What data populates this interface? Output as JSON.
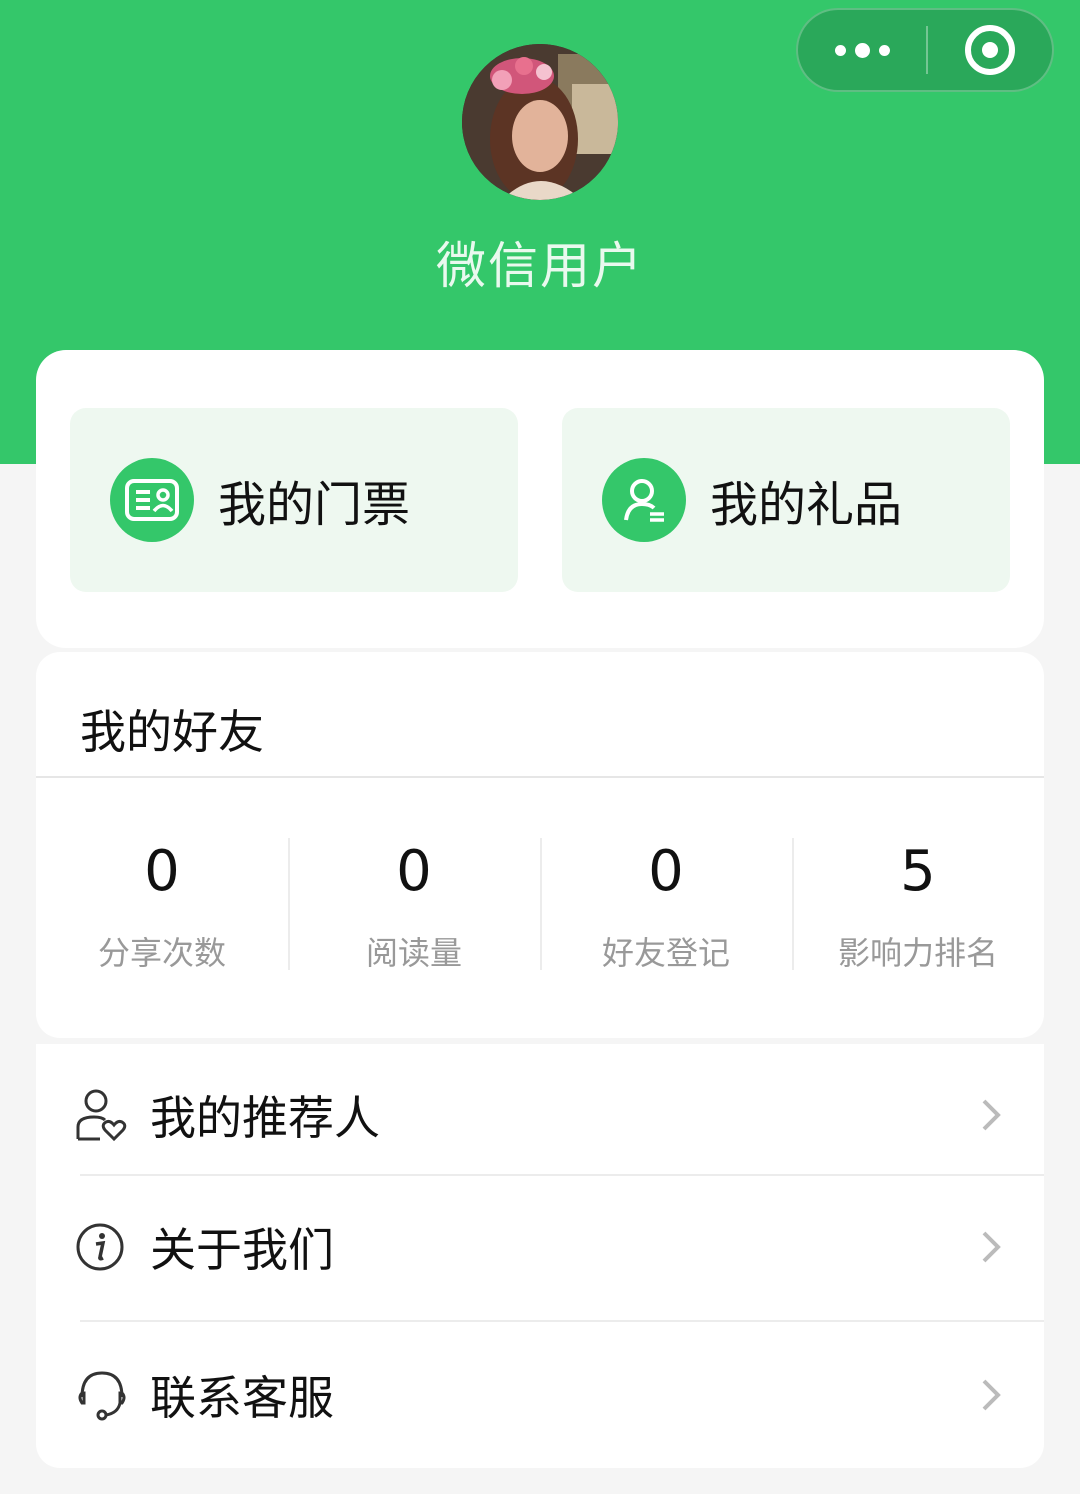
{
  "header": {
    "capsule": {
      "more_icon": "more-dots-icon",
      "close_icon": "target-close-icon"
    },
    "avatar_alt": "user avatar",
    "nickname": "微信用户",
    "bg_color": "#34c76a"
  },
  "quick_actions": [
    {
      "label": "我的门票",
      "icon": "ticket-card-icon"
    },
    {
      "label": "我的礼品",
      "icon": "user-gift-icon"
    }
  ],
  "friends": {
    "title": "我的好友",
    "stats": [
      {
        "value": "0",
        "label": "分享次数"
      },
      {
        "value": "0",
        "label": "阅读量"
      },
      {
        "value": "0",
        "label": "好友登记"
      },
      {
        "value": "5",
        "label": "影响力排名"
      }
    ]
  },
  "menu": [
    {
      "label": "我的推荐人",
      "icon": "user-heart-icon"
    },
    {
      "label": "关于我们",
      "icon": "info-icon"
    },
    {
      "label": "联系客服",
      "icon": "headset-icon"
    }
  ]
}
